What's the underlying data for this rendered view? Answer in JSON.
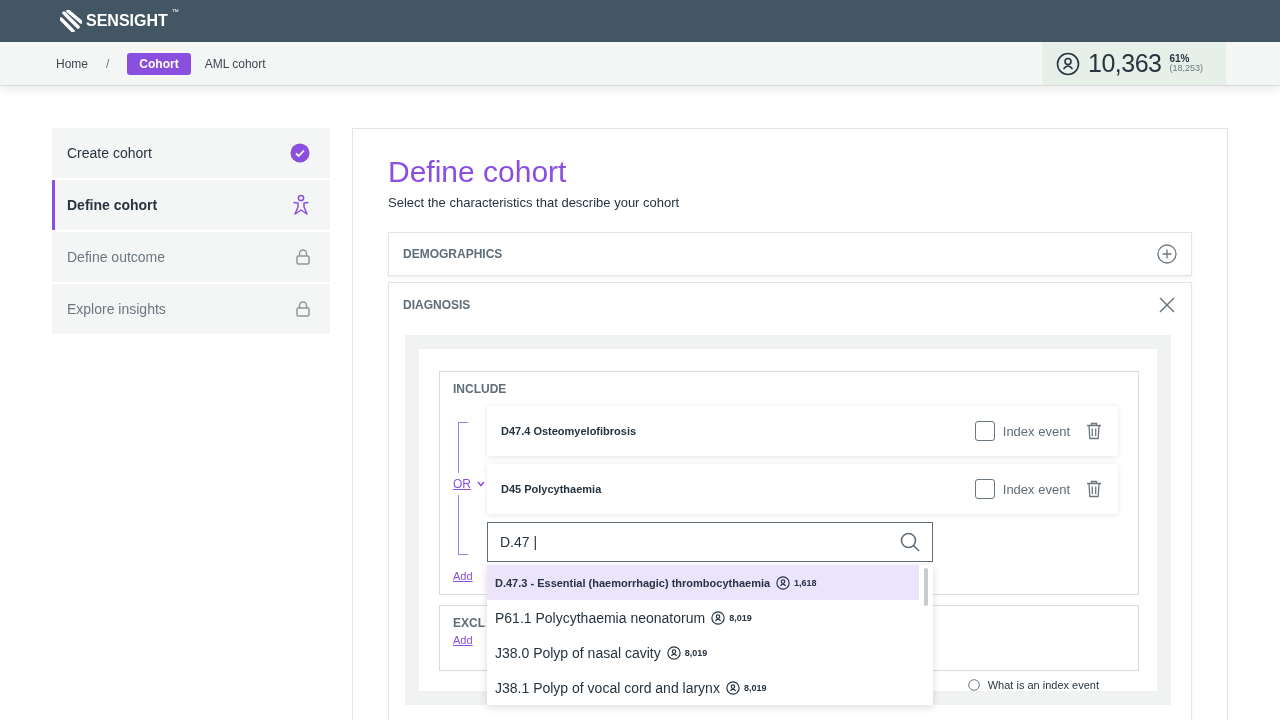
{
  "header": {
    "logo": "SENSIGHT",
    "trademark": "™"
  },
  "breadcrumb": {
    "home": "Home",
    "separator": "/",
    "path": [
      {
        "label": "Cohort",
        "selected": true
      },
      {
        "label": "AML cohort",
        "selected": false
      }
    ]
  },
  "patient_count": {
    "value": "10,363",
    "percent": "61%",
    "total": "(18,253)"
  },
  "steps": [
    {
      "label": "Create cohort",
      "selected": false,
      "kind": "done"
    },
    {
      "label": "Define cohort",
      "selected": true,
      "kind": "active"
    },
    {
      "label": "Define outcome",
      "selected": false,
      "kind": "locked"
    },
    {
      "label": "Explore insights",
      "selected": false,
      "kind": "locked"
    }
  ],
  "title": "Define cohort",
  "subtitle": "Select the characteristics that describe your cohort",
  "sections": [
    {
      "label": "DEMOGRAPHICS",
      "expanded": false
    },
    {
      "label": "DIAGNOSIS",
      "expanded": true
    }
  ],
  "include": {
    "label": "INCLUDE",
    "operator": "OR",
    "add": "Add",
    "items": [
      {
        "label": "D47.4 Osteomyelofibrosis",
        "index_label": "Index event",
        "checked": false
      },
      {
        "label": "D45 Polycythaemia",
        "index_label": "Index event",
        "checked": false
      }
    ],
    "search": {
      "value": "D.47 |"
    },
    "results": [
      {
        "label": "D.47.3 - Essential (haemorrhagic) thrombocythaemia",
        "count": "1,618",
        "selected": true
      },
      {
        "label": "P61.1 Polycythaemia neonatorum",
        "count": "8,019",
        "selected": false
      },
      {
        "label": "J38.0 Polyp of nasal cavity",
        "count": "8,019",
        "selected": false
      },
      {
        "label": "J38.1 Polyp of vocal cord and larynx",
        "count": "8,019",
        "selected": false
      }
    ]
  },
  "exclude": {
    "label": "EXCL",
    "add": "Add"
  },
  "help_link": "What is an index event"
}
